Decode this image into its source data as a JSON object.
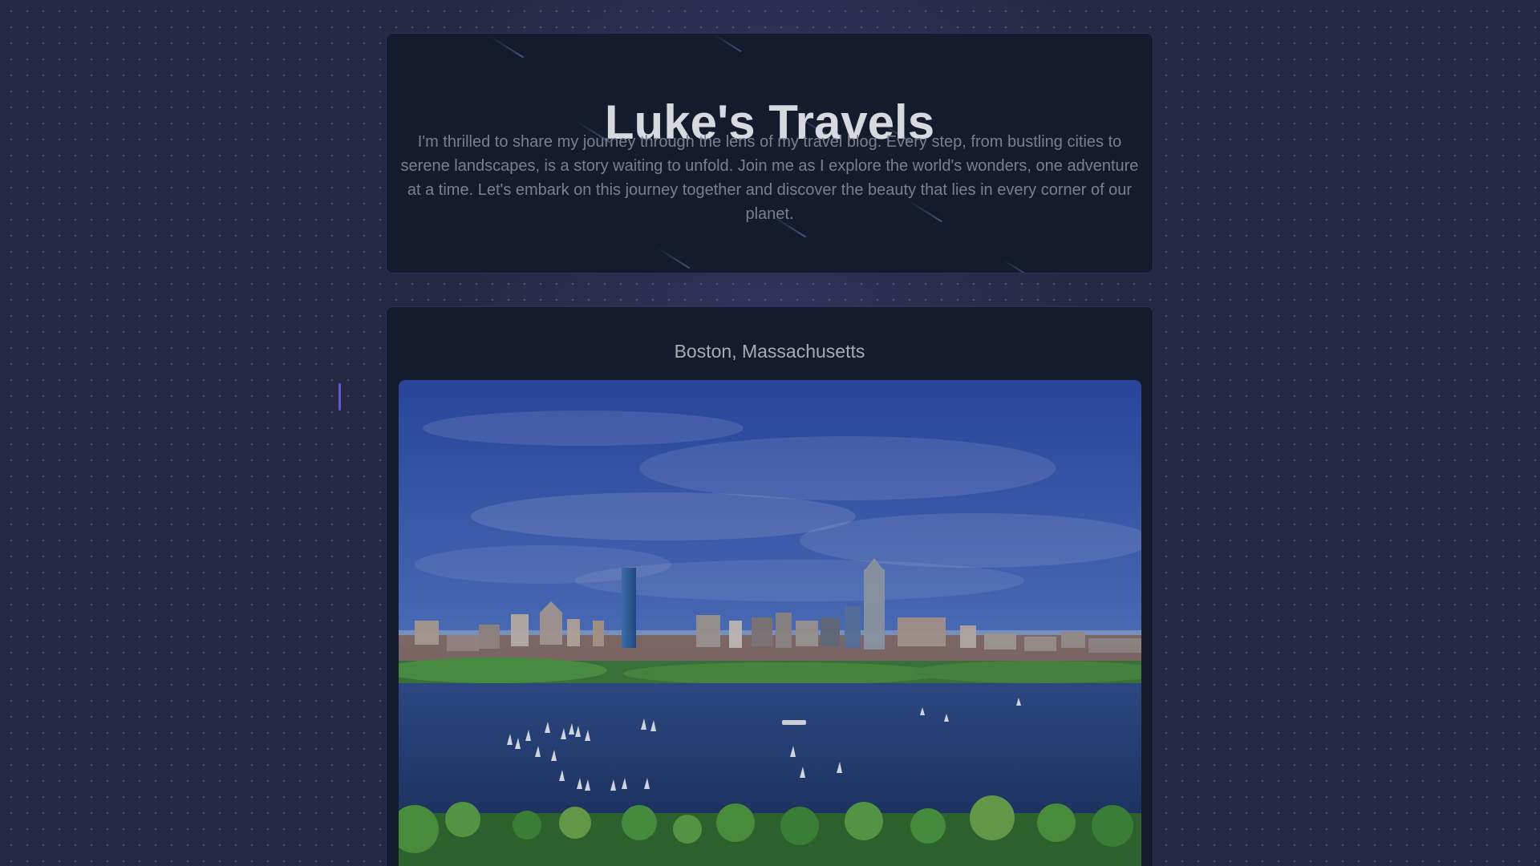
{
  "header": {
    "title": "Luke's Travels",
    "intro": "I'm thrilled to share my journey through the lens of my travel blog. Every step, from bustling cities to serene landscapes, is a story waiting to unfold. Join me as I explore the world's wonders, one adventure at a time. Let's embark on this journey together and discover the beauty that lies in every corner of our planet."
  },
  "post": {
    "location": "Boston, Massachusetts",
    "photo_subject": "Boston skyline across the Charles River with sailboats"
  },
  "colors": {
    "page_background": "#262843",
    "card_background": "#151b2d",
    "card_border": "#2c3160",
    "title_text": "#d8d9de",
    "body_text": "#7b7f8d",
    "accent": "#5a5ad8"
  }
}
